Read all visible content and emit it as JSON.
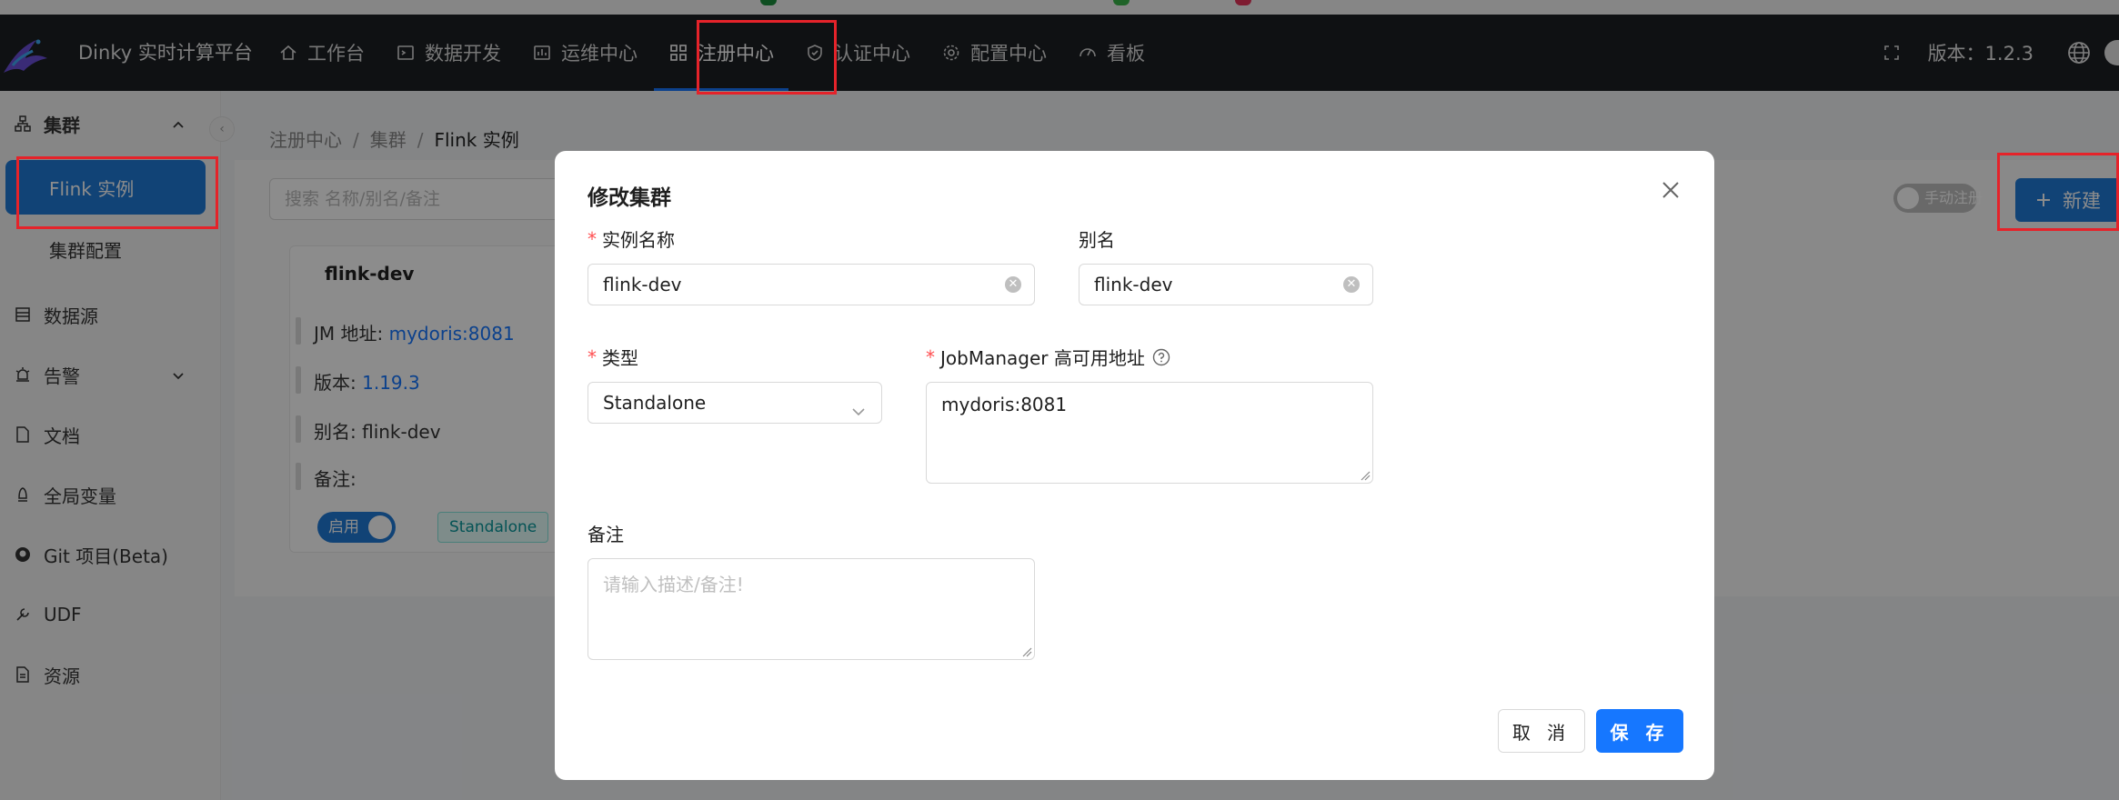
{
  "app": {
    "title": "Dinky 实时计算平台",
    "version": "版本：1.2.3"
  },
  "nav": [
    {
      "label": "工作台",
      "icon": "home-icon"
    },
    {
      "label": "数据开发",
      "icon": "terminal-icon"
    },
    {
      "label": "运维中心",
      "icon": "fund-icon"
    },
    {
      "label": "注册中心",
      "icon": "appstore-icon",
      "active": true
    },
    {
      "label": "认证中心",
      "icon": "safety-icon"
    },
    {
      "label": "配置中心",
      "icon": "setting-icon"
    },
    {
      "label": "看板",
      "icon": "dashboard-icon"
    }
  ],
  "sidebar": {
    "group": "集群",
    "sub_items": [
      "Flink 实例",
      "集群配置"
    ],
    "items": [
      {
        "label": "数据源",
        "icon": "database-icon"
      },
      {
        "label": "告警",
        "icon": "alert-icon"
      },
      {
        "label": "文档",
        "icon": "file-icon"
      },
      {
        "label": "全局变量",
        "icon": "variable-icon"
      },
      {
        "label": "Git 项目(Beta)",
        "icon": "github-icon"
      },
      {
        "label": "UDF",
        "icon": "tool-icon"
      },
      {
        "label": "资源",
        "icon": "folder-icon"
      }
    ]
  },
  "breadcrumb": [
    "注册中心",
    "集群",
    "Flink 实例"
  ],
  "toolbar": {
    "search_placeholder": "搜索 名称/别名/备注",
    "manual_register": "手动注册",
    "new_button": "新建"
  },
  "card": {
    "title": "flink-dev",
    "jm_label": "JM 地址: ",
    "jm_value": "mydoris:8081",
    "version_label": "版本: ",
    "version_value": "1.19.3",
    "alias": "别名: flink-dev",
    "note": "备注:",
    "enabled": "启用",
    "type_tag": "Standalone"
  },
  "modal": {
    "title": "修改集群",
    "name_label": "实例名称",
    "name_value": "flink-dev",
    "alias_label": "别名",
    "alias_value": "flink-dev",
    "type_label": "类型",
    "type_value": "Standalone",
    "jm_label": "JobManager 高可用地址",
    "jm_value": "mydoris:8081",
    "note_label": "备注",
    "note_placeholder": "请输入描述/备注!",
    "cancel": "取 消",
    "save": "保 存"
  },
  "colors": {
    "primary": "#1677ff",
    "header_bg": "#1c1f23",
    "highlight_box": "#e5232a"
  }
}
